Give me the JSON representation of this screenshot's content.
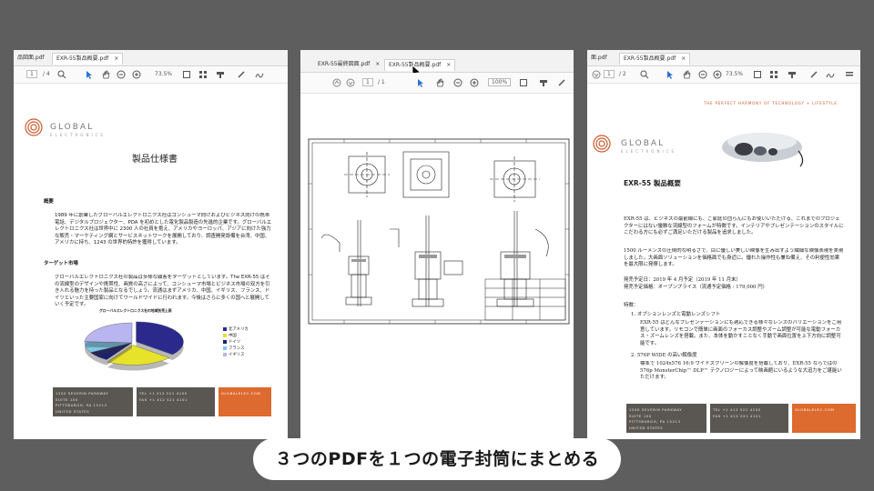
{
  "panel1": {
    "tabs": [
      {
        "label": "品図面.pdf"
      },
      {
        "label": "EXR-55製品概要.pdf",
        "close": "×"
      }
    ],
    "toolbar": {
      "page": "1",
      "total": "/ 4",
      "zoom": "73.5%"
    },
    "brand": {
      "name": "GLOBAL",
      "sub": "ELECTRONICS"
    },
    "title": "製品仕様書",
    "section1_heading": "概要",
    "section1_text": "1989 年に創業したグローバルエレクトロニクス社はコンシューマ向けおよびビジネス向けの携帯電話、デジタルプロジェクター、PDA を初めとした電化製品製造の先進的企業です。グローバルエレクトロニクス社は世界中に 2300 人の社員を抱え、アメリカやヨーロッパ、アジアに向けた強力な販売・マーケティング網とサービスネットワークを展開しており、調査開発設備を台湾、中国、アメリカに持ち、1243 の世界的特許を獲得しています。",
    "section2_heading": "ターゲット市場",
    "section2_text": "グローバルエレクトロニクス社の製品は多様な顧客をターゲットとしています。The EXR-55 はその流線型のデザインや携帯性、画質の高さによって、コンシューマ市場とビジネス市場の双方を引き入れる魅力を持った製品となるでしょう。流通はまずアメリカ、中国、イギリス、フランス、ドイツといった主要国家に向けてワールドワイドに行われます。今後はさらに多くの国へと展開していく予定です。",
    "chart_data": {
      "type": "pie",
      "title": "グローバルエレクトロニクス社の地域別売上高",
      "categories": [
        "北アメリカ",
        "中国",
        "ドイツ",
        "フランス",
        "イギリス"
      ],
      "values": [
        36,
        23,
        8,
        9,
        24
      ],
      "colors": [
        "#2b2a8c",
        "#e7e22a",
        "#1c2070",
        "#7ec8e8",
        "#b9b5f0"
      ]
    },
    "footer": {
      "col1": [
        "1200 SEVERIN PARKWAY",
        "SUITE 100",
        "PITTSBURGH, PA 15213",
        "UNITED STATES"
      ],
      "col2": [
        "TEL +1 412 521 4100",
        "FAX +1 412 521 4101"
      ],
      "col3": [
        "GLOBALELEC.COM"
      ]
    }
  },
  "panel2": {
    "tabs": [
      {
        "label": "EXR-55最終図面.pdf",
        "close": "×"
      },
      {
        "label": "EXR-55製品概要.pdf",
        "close": "×"
      }
    ],
    "toolbar": {
      "page": "1",
      "total": "/ 1",
      "zoom": "100%"
    }
  },
  "panel3": {
    "tabs": [
      {
        "label": "面.pdf"
      },
      {
        "label": "EXR-55製品概要.pdf",
        "close": "×"
      }
    ],
    "toolbar": {
      "page": "1",
      "total": "/ 2",
      "zoom": "73.5%"
    },
    "tagline": "THE PERFECT HARMONY OF TECHNOLOGY + LIFESTYLE.",
    "brand": {
      "name": "GLOBAL",
      "sub": "ELECTRONICS"
    },
    "title": "EXR-55 製品概要",
    "para1": "EXR-55 は、ビジネスの最前線にも、ご家庭の団らんにもお使いいただける、これまでのプロジェクターにはない優雅な流線型のフォームが特徴です。インテリアやプレゼンテーションのスタイルにこだわる方にも必ずご満足いただける製品を追求しました。",
    "para2": "1500 ルーメンスの圧倒的な明るさで、目に優しい美しい映像を生み出すよう繊細な映像表現を実現しました。大画面ソリューションを価格面でも身近に。優れた操作性も兼ね備え、その利便性効果を最大限に発揮します。",
    "release": "発売予定日：2019 年 4 月予定（2019 年 11 月末）",
    "price": "発売予定価格：オープンプライス（流通予定価格 : 179,000 円）",
    "features_heading": "特徴：",
    "feature1_title": "1.  オプションレンズと電動レンズシフト",
    "feature1_text": "EXR-55 はどんなプレゼンテーションにも適応できる様々なレンズのバリエーションをご用意しています。リモコンで簡単に画面のフォーカス調整やズーム調整が可能な電動フォーカス・ズームレンズを搭載。また、本体を動かすことなく手動で画面位置を上下方向に調整可能です。",
    "feature2_title": "2.  576P WIDE の高い解像度",
    "feature2_text": "標準で 1024x576 16:9 ワイドスクリーンの解像度を搭載しており、EXR-55 ならではの 576p MonsterChip™ DLP™ テクノロジーによって映画館にいるような大迫力をご堪能いただけます。",
    "footer": {
      "col1": [
        "1200 SEVERIN PARKWAY",
        "SUITE 100",
        "PITTSBURGH, PA 15213",
        "UNITED STATES"
      ],
      "col2": [
        "TEL +1 412 521 4100",
        "FAX +1 412 521 4101"
      ],
      "col3": [
        "GLOBALELEC.COM"
      ]
    }
  },
  "caption": "３つのPDFを１つの電子封筒にまとめる",
  "colors": {
    "accent_orange": "#dd6a2e",
    "footer_gray": "#5a5752",
    "brand_red": "#c9582b"
  }
}
